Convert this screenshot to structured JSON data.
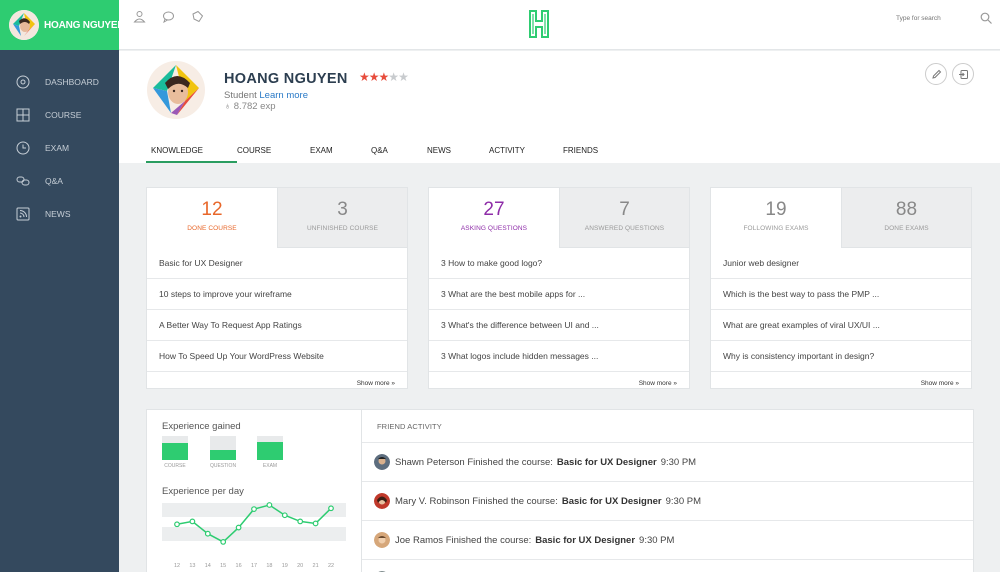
{
  "user": {
    "name": "HOANG NGUYEN",
    "role": "Student",
    "learn_more": "Learn more",
    "exp": "8.782 exp",
    "rating": 3,
    "rating_max": 5
  },
  "sidebar": {
    "items": [
      {
        "label": "DASHBOARD",
        "icon": "dashboard-icon"
      },
      {
        "label": "COURSE",
        "icon": "grid-icon"
      },
      {
        "label": "EXAM",
        "icon": "clock-icon"
      },
      {
        "label": "Q&A",
        "icon": "chat-bubbles-icon"
      },
      {
        "label": "NEWS",
        "icon": "rss-icon"
      }
    ]
  },
  "topbar": {
    "search_placeholder": "Type for search"
  },
  "tabs": [
    "KNOWLEDGE",
    "COURSE",
    "EXAM",
    "Q&A",
    "NEWS",
    "ACTIVITY",
    "FRIENDS"
  ],
  "active_tab": "KNOWLEDGE",
  "cards": [
    {
      "tabs": [
        {
          "num": "12",
          "label": "DONE COURSE",
          "color": "#e8672a"
        },
        {
          "num": "3",
          "label": "UNFINISHED COURSE"
        }
      ],
      "items": [
        "Basic for UX Designer",
        "10 steps to improve your wireframe",
        "A Better Way To Request App Ratings",
        "How To Speed Up Your WordPress Website"
      ],
      "more": "Show more"
    },
    {
      "tabs": [
        {
          "num": "27",
          "label": "ASKING QUESTIONS",
          "color": "#8e2ca8"
        },
        {
          "num": "7",
          "label": "ANSWERED QUESTIONS"
        }
      ],
      "items": [
        "3 How to make good logo?",
        "3 What are the best mobile apps for ...",
        "3 What's the difference between UI and ...",
        "3 What logos include hidden messages ..."
      ],
      "more": "Show more"
    },
    {
      "tabs": [
        {
          "num": "19",
          "label": "FOLLOWING EXAMS"
        },
        {
          "num": "88",
          "label": "DONE EXAMS"
        }
      ],
      "items": [
        "Junior web designer",
        "Which is the best way to pass the PMP ...",
        "What are great examples of viral UX/UI ...",
        "Why is consistency important in design?"
      ],
      "more": "Show more"
    }
  ],
  "experience": {
    "title": "Experience gained",
    "bars": [
      {
        "label": "COURSE",
        "fraction": 0.7
      },
      {
        "label": "QUESTION",
        "fraction": 0.4
      },
      {
        "label": "EXAM",
        "fraction": 0.75
      }
    ]
  },
  "experience_per_day": {
    "title": "Experience per day",
    "x": [
      "12",
      "13",
      "14",
      "15",
      "16",
      "17",
      "18",
      "19",
      "20",
      "21",
      "22"
    ],
    "values": [
      0.53,
      0.6,
      0.3,
      0.1,
      0.45,
      0.9,
      1.0,
      0.75,
      0.6,
      0.55,
      0.92
    ]
  },
  "friend_activity": {
    "title": "FRIEND ACTIVITY",
    "rows": [
      {
        "name": "Shawn Peterson",
        "action": "Finished the course:",
        "course": "Basic for UX Designer",
        "time": "9:30 PM"
      },
      {
        "name": "Mary V. Robinson",
        "action": "Finished the course:",
        "course": "Basic for UX Designer",
        "time": "9:30 PM"
      },
      {
        "name": "Joe Ramos",
        "action": "Finished the course:",
        "course": "Basic for UX Designer",
        "time": "9:30 PM"
      }
    ]
  },
  "colors": {
    "accent": "#2ecc71",
    "sidebar": "#34495e",
    "link": "#2a7ac7",
    "star": "#e74c3c"
  }
}
